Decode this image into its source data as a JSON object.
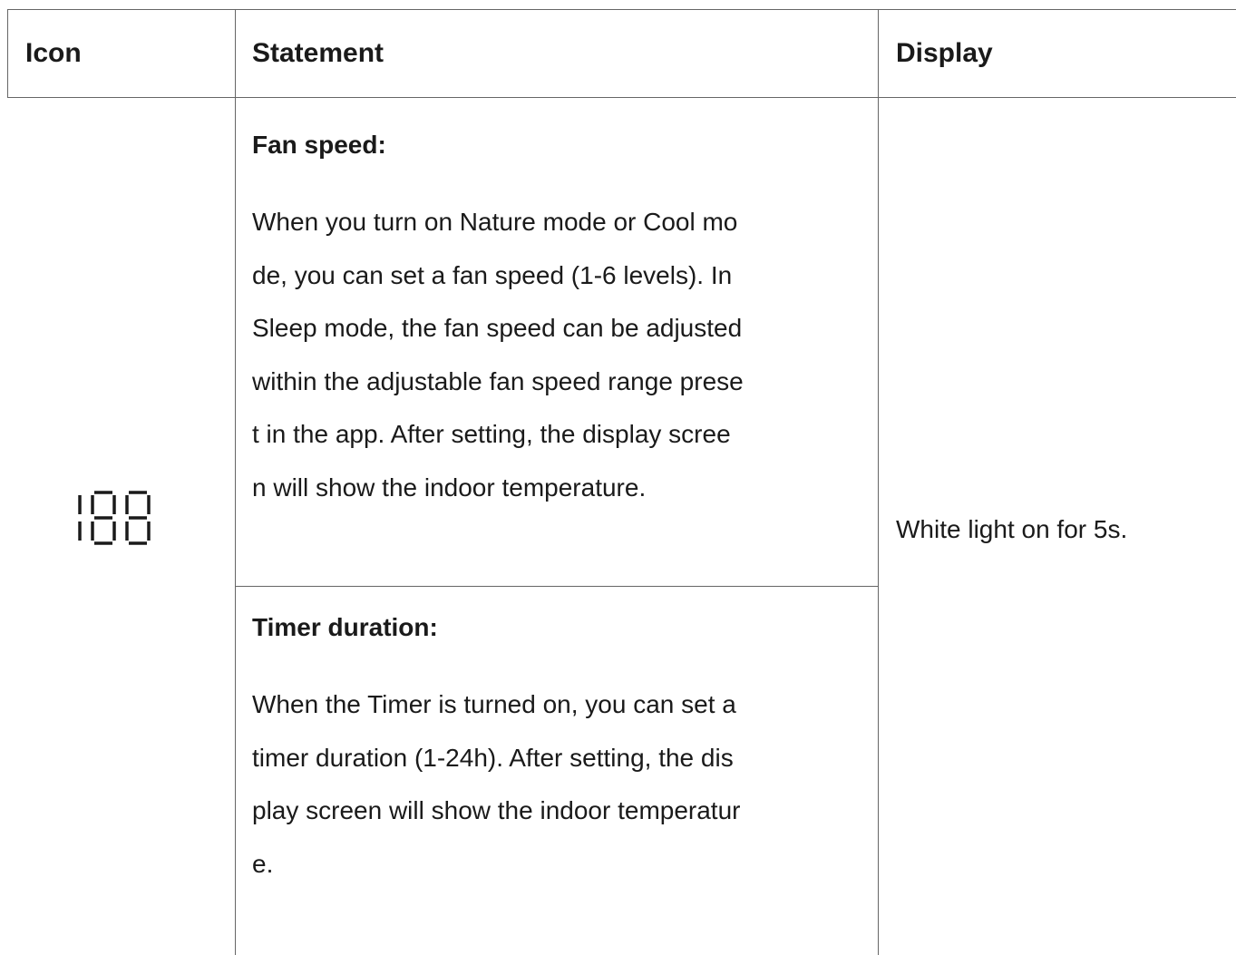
{
  "table": {
    "headers": {
      "icon": "Icon",
      "statement": "Statement",
      "display": "Display"
    },
    "row": {
      "icon_name": "seven-segment-188-icon",
      "display": "White light on for 5s.",
      "statements": [
        {
          "title": "Fan speed:",
          "lines": [
            "When you turn on Nature mode or Cool mo",
            "de, you can set a fan speed (1-6 levels). In",
            "Sleep mode, the fan speed can be adjusted",
            "within the adjustable fan speed range prese",
            "t in the app. After setting, the display scree",
            "n will show the indoor temperature."
          ]
        },
        {
          "title": "Timer duration:",
          "lines": [
            "When the Timer is turned on, you can set a",
            "timer duration (1-24h). After setting, the dis",
            "play screen will show the indoor temperatur",
            "e."
          ]
        }
      ]
    }
  }
}
